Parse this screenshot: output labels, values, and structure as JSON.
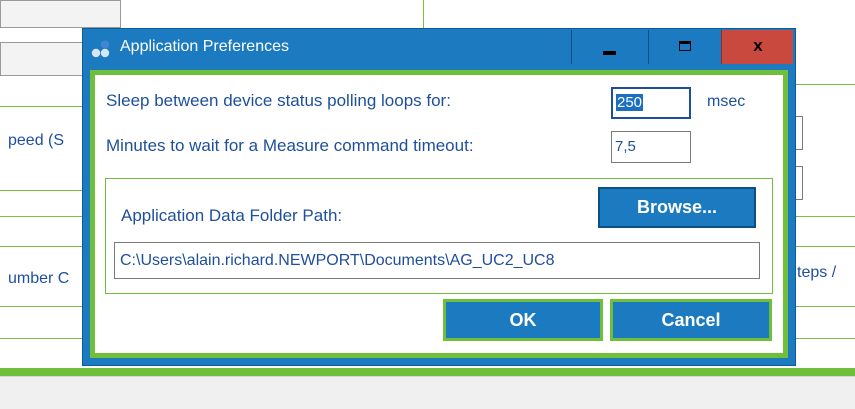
{
  "background": {
    "partial_labels": {
      "speed": "peed (S",
      "number": "umber C",
      "steps": "teps /"
    }
  },
  "dialog": {
    "title": "Application Preferences",
    "controls": {
      "minimize_icon": "minimize-icon",
      "maximize_icon": "maximize-icon",
      "close_label": "x"
    },
    "sleep": {
      "label": "Sleep between device status polling loops for:",
      "value": "250",
      "unit": "msec"
    },
    "timeout": {
      "label": "Minutes to wait for a Measure command timeout:",
      "value": "7,5"
    },
    "data_folder": {
      "label": "Application Data Folder Path:",
      "browse_label": "Browse...",
      "path": "C:\\Users\\alain.richard.NEWPORT\\Documents\\AG_UC2_UC8"
    },
    "ok_label": "OK",
    "cancel_label": "Cancel"
  },
  "colors": {
    "title_bar": "#1c7ac0",
    "accent_green": "#6fbf3a",
    "close_button": "#c9493f",
    "label_text": "#1e4f9c"
  }
}
